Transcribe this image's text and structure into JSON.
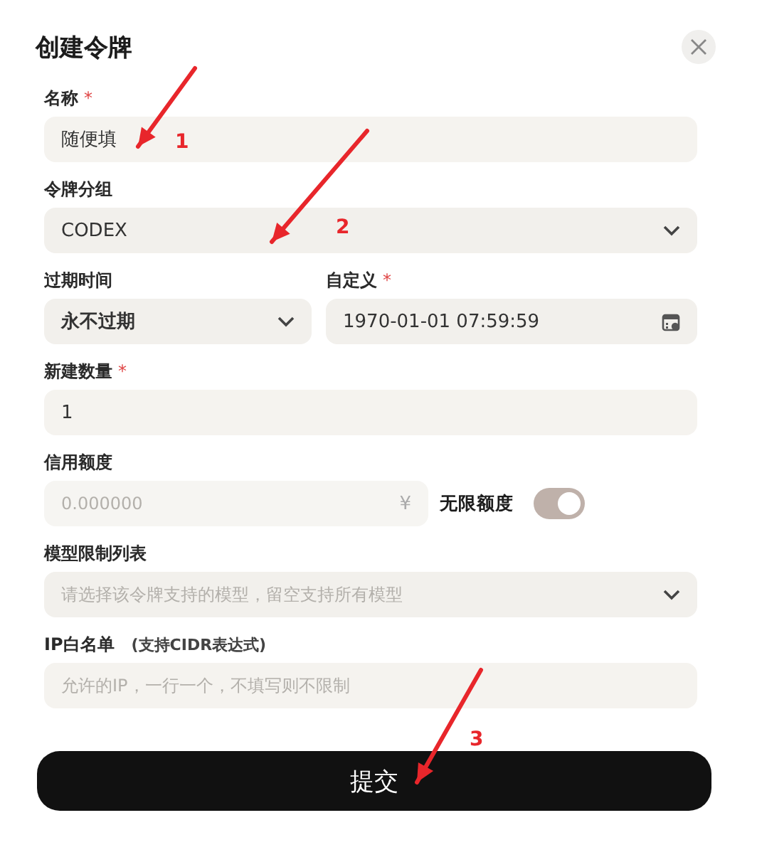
{
  "dialog": {
    "title": "创建令牌"
  },
  "rows": [
    [
      {
        "kind": "text",
        "label": "名称",
        "required_mark": "*",
        "value": "随便填"
      }
    ],
    [
      {
        "kind": "select",
        "label": "令牌分组",
        "value": "CODEX"
      }
    ],
    [
      {
        "kind": "select",
        "label": "过期时间",
        "value": "永不过期"
      },
      {
        "kind": "datetime",
        "label": "自定义",
        "required_mark": "*",
        "value": "1970-01-01 07:59:59"
      }
    ],
    [
      {
        "kind": "text",
        "label": "新建数量",
        "required_mark": "*",
        "value": "1"
      }
    ],
    [
      {
        "kind": "currency",
        "label": "信用额度",
        "placeholder": "0.000000",
        "suffix": "¥"
      },
      {
        "kind": "switch",
        "label": "无限额度",
        "on": true
      }
    ],
    [
      {
        "kind": "select",
        "label": "模型限制列表",
        "placeholder": "请选择该令牌支持的模型，留空支持所有模型"
      }
    ],
    [
      {
        "kind": "textarea",
        "label": "IP白名单",
        "hint": "(支持CIDR表达式)",
        "placeholder": "允许的IP，一行一个，不填写则不限制"
      }
    ]
  ],
  "submit": "提交",
  "annotations": [
    {
      "number": "1"
    },
    {
      "number": "2"
    },
    {
      "number": "3"
    }
  ]
}
